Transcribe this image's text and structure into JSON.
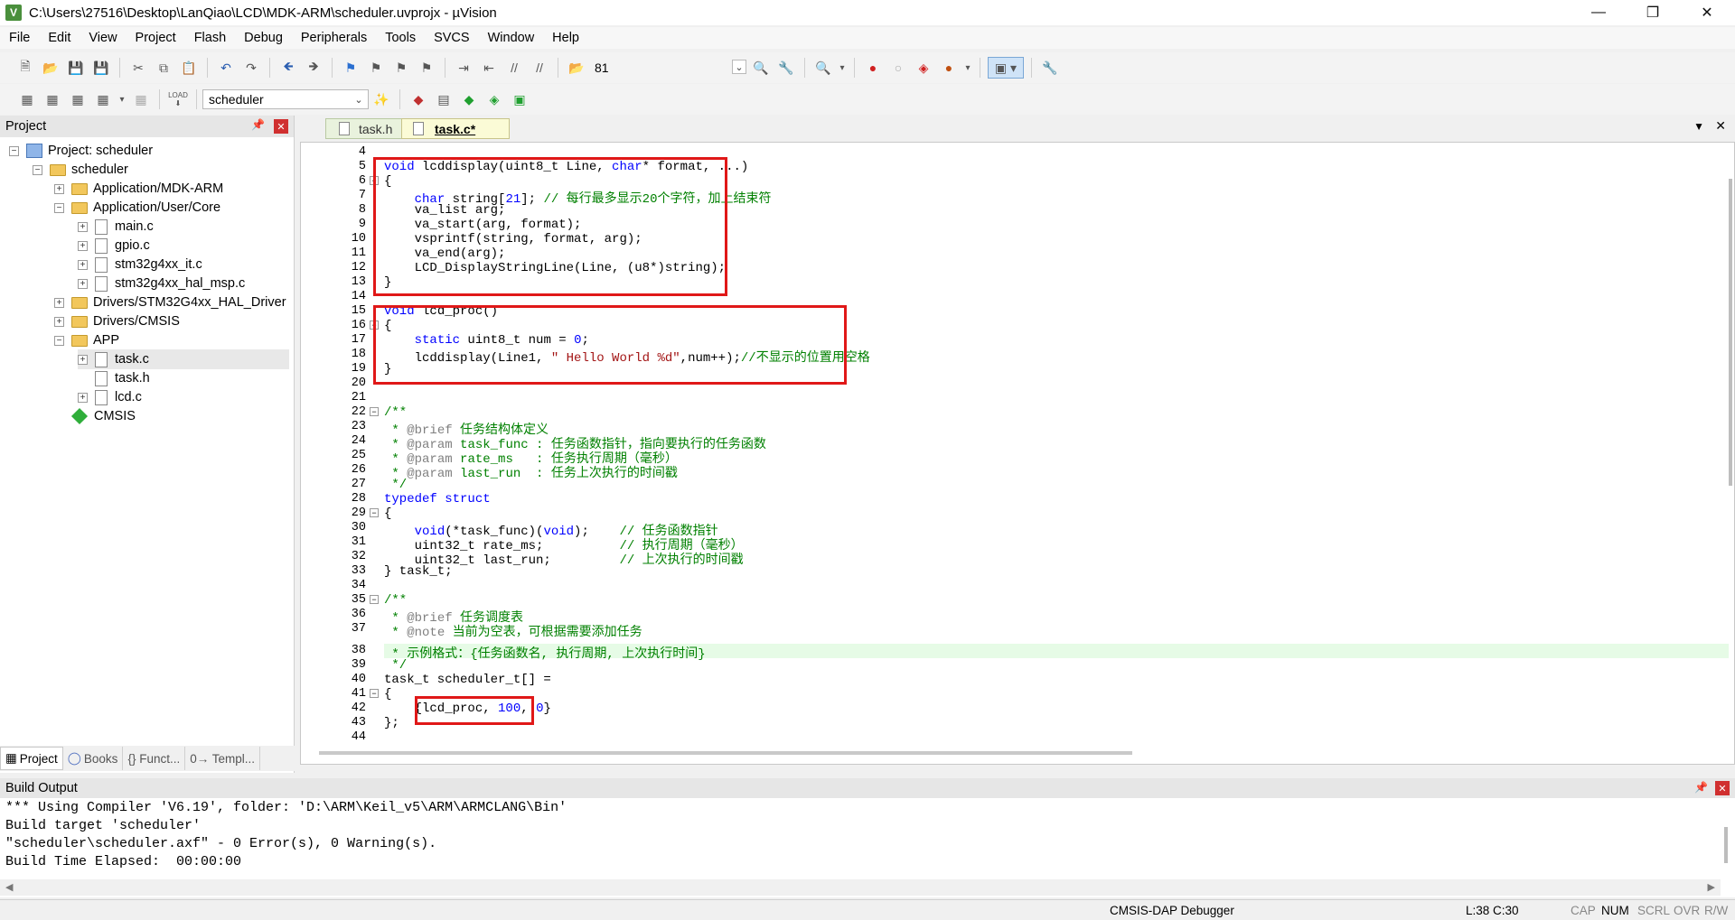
{
  "window": {
    "title": "C:\\Users\\27516\\Desktop\\LanQiao\\LCD\\MDK-ARM\\scheduler.uvprojx - µVision",
    "app_icon": "V"
  },
  "menu": [
    "File",
    "Edit",
    "View",
    "Project",
    "Flash",
    "Debug",
    "Peripherals",
    "Tools",
    "SVCS",
    "Window",
    "Help"
  ],
  "toolbar": {
    "find_value": "81",
    "target_value": "scheduler",
    "load_label": "LOAD"
  },
  "project_panel": {
    "title": "Project",
    "tree": [
      {
        "label": "Project: scheduler"
      },
      {
        "label": "scheduler"
      },
      {
        "label": "Application/MDK-ARM"
      },
      {
        "label": "Application/User/Core"
      },
      {
        "label": "main.c"
      },
      {
        "label": "gpio.c"
      },
      {
        "label": "stm32g4xx_it.c"
      },
      {
        "label": "stm32g4xx_hal_msp.c"
      },
      {
        "label": "Drivers/STM32G4xx_HAL_Driver"
      },
      {
        "label": "Drivers/CMSIS"
      },
      {
        "label": "APP"
      },
      {
        "label": "task.c"
      },
      {
        "label": "task.h"
      },
      {
        "label": "lcd.c"
      },
      {
        "label": "CMSIS"
      }
    ],
    "tabs": [
      "Project",
      "Books",
      "{} Funct...",
      "0→ Templ..."
    ]
  },
  "editor": {
    "tabs": [
      "task.h",
      "task.c*"
    ],
    "line_numbers": [
      "4",
      "5",
      "6",
      "7",
      "8",
      "9",
      "10",
      "11",
      "12",
      "13",
      "14",
      "15",
      "16",
      "17",
      "18",
      "19",
      "20",
      "21",
      "22",
      "23",
      "24",
      "25",
      "26",
      "27",
      "28",
      "29",
      "30",
      "31",
      "32",
      "33",
      "34",
      "35",
      "36",
      "37",
      "38",
      "39",
      "40",
      "41",
      "42",
      "43",
      "44"
    ],
    "code": {
      "l5a": "void",
      "l5b": " lcddisplay(uint8_t Line, ",
      "l5c": "char",
      "l5d": "* format, ...)",
      "l6": "{",
      "l7a": "    ",
      "l7b": "char",
      "l7c": " string[",
      "l7d": "21",
      "l7e": "]; ",
      "l7f": "// 每行最多显示20个字符，加上结束符",
      "l8": "    va_list arg;",
      "l9": "    va_start(arg, format);",
      "l10": "    vsprintf(string, format, arg);",
      "l11": "    va_end(arg);",
      "l12": "    LCD_DisplayStringLine(Line, (u8*)string);",
      "l13": "}",
      "l15a": "void",
      "l15b": " lcd_proc()",
      "l16": "{",
      "l17a": "    ",
      "l17b": "static",
      "l17c": " uint8_t num = ",
      "l17d": "0",
      "l17e": ";",
      "l18a": "    lcddisplay(Line1, ",
      "l18b": "\" Hello World %d\"",
      "l18c": ",num++);",
      "l18d": "//不显示的位置用空格",
      "l19": "}",
      "l22": "/**",
      "l23a": " * ",
      "l23b": "@brief",
      "l23c": " 任务结构体定义",
      "l24a": " * ",
      "l24b": "@param",
      "l24c": " task_func : 任务函数指针，指向要执行的任务函数",
      "l25a": " * ",
      "l25b": "@param",
      "l25c": " rate_ms   : 任务执行周期（毫秒）",
      "l26a": " * ",
      "l26b": "@param",
      "l26c": " last_run  : 任务上次执行的时间戳",
      "l27": " */",
      "l28a": "typedef",
      "l28b": " ",
      "l28c": "struct",
      "l29": "{",
      "l30a": "    ",
      "l30b": "void",
      "l30c": "(*task_func)(",
      "l30d": "void",
      "l30e": ");    ",
      "l30f": "// 任务函数指针",
      "l31a": "    uint32_t rate_ms;          ",
      "l31b": "// 执行周期（毫秒）",
      "l32a": "    uint32_t last_run;         ",
      "l32b": "// 上次执行的时间戳",
      "l33": "} task_t;",
      "l35": "/**",
      "l36a": " * ",
      "l36b": "@brief",
      "l36c": " 任务调度表",
      "l37a": " * ",
      "l37b": "@note",
      "l37c": " 当前为空表，可根据需要添加任务",
      "l38": " * 示例格式：{任务函数名, 执行周期, 上次执行时间}",
      "l39": " */",
      "l40": "task_t scheduler_t[] =",
      "l41": "{",
      "l42a": "    {lcd_proc, ",
      "l42b": "100",
      "l42c": ", ",
      "l42d": "0",
      "l42e": "}",
      "l43": "};"
    }
  },
  "build_output": {
    "title": "Build Output",
    "lines": [
      "*** Using Compiler 'V6.19', folder: 'D:\\ARM\\Keil_v5\\ARM\\ARMCLANG\\Bin'",
      "Build target 'scheduler'",
      "\"scheduler\\scheduler.axf\" - 0 Error(s), 0 Warning(s).",
      "Build Time Elapsed:  00:00:00"
    ]
  },
  "statusbar": {
    "debugger": "CMSIS-DAP Debugger",
    "position": "L:38 C:30",
    "cap": "CAP",
    "num": "NUM",
    "scrl": "SCRL",
    "ovr": "OVR",
    "rw": "R/W"
  }
}
